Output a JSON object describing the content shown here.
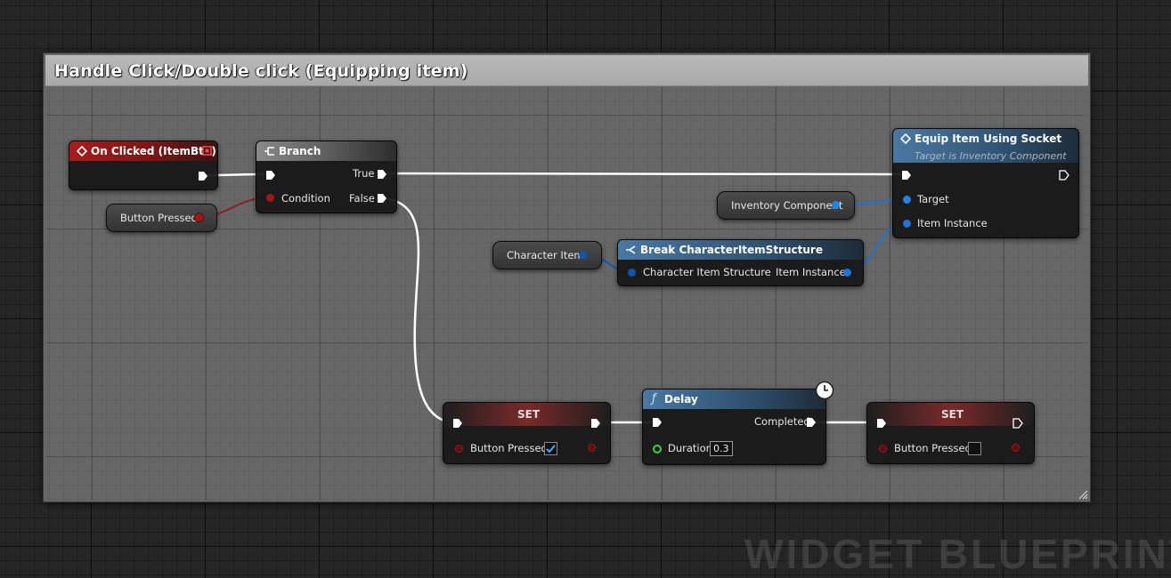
{
  "comment": {
    "title": "Handle Click/Double click (Equipping item)"
  },
  "watermark": "WIDGET BLUEPRINT",
  "nodes": {
    "on_clicked": {
      "title": "On Clicked (ItemBtn)"
    },
    "button_pressed_getter": {
      "label": "Button Pressed"
    },
    "branch": {
      "title": "Branch",
      "pin_true": "True",
      "pin_condition": "Condition",
      "pin_false": "False"
    },
    "equip_item": {
      "title": "Equip Item Using Socket",
      "subtitle": "Target is Inventory Component",
      "pin_target": "Target",
      "pin_item_instance": "Item Instance"
    },
    "inventory_component_getter": {
      "label": "Inventory Component"
    },
    "character_item_getter": {
      "label": "Character Item"
    },
    "break_struct": {
      "title": "Break CharacterItemStructure",
      "pin_input": "Character Item Structure",
      "pin_output": "Item Instance"
    },
    "set_true": {
      "title": "SET",
      "pin_label": "Button Pressed",
      "checked": true
    },
    "delay": {
      "title": "Delay",
      "pin_completed": "Completed",
      "pin_duration": "Duration",
      "duration_value": "0.3"
    },
    "set_false": {
      "title": "SET",
      "pin_label": "Button Pressed",
      "checked": false
    }
  },
  "colors": {
    "exec_wire": "#ffffff",
    "bool_wire": "#8c1f1f",
    "object_wire": "#1e74d8",
    "struct_wire": "#0e55b8",
    "float_pin": "#3dd13d",
    "event_header": "#a81c1c",
    "function_header": "#4a78a3"
  }
}
